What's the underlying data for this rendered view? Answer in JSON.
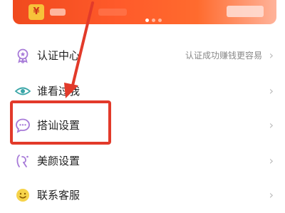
{
  "banner": {
    "coin_symbol": "¥"
  },
  "menu": {
    "items": [
      {
        "label": "认证中心",
        "hint": "认证成功赚钱更容易",
        "icon": "badge-icon"
      },
      {
        "label": "谁看过我",
        "hint": "",
        "icon": "eye-icon"
      },
      {
        "label": "搭讪设置",
        "hint": "",
        "icon": "chat-bubble-icon"
      },
      {
        "label": "美颜设置",
        "hint": "",
        "icon": "beauty-icon"
      },
      {
        "label": "联系客服",
        "hint": "",
        "icon": "smiley-face-icon"
      }
    ]
  },
  "colors": {
    "accent": "#e23a2a",
    "icon_purple": "#a77ad8"
  }
}
